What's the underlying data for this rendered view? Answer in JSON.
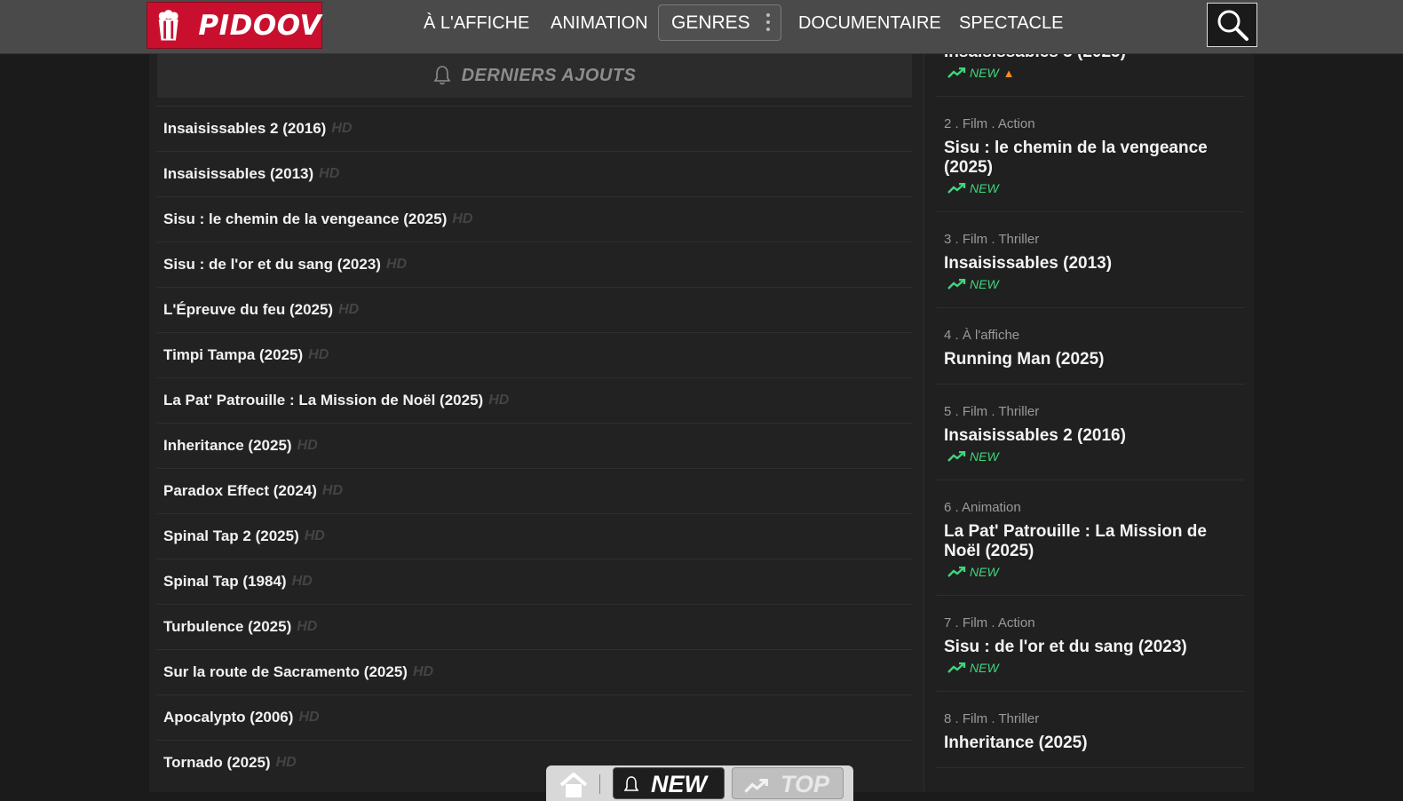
{
  "header": {
    "logo_text": "PIDOOV",
    "nav": {
      "affiche": "À L'AFFICHE",
      "animation": "ANIMATION",
      "genres": "GENRES",
      "documentaire": "DOCUMENTAIRE",
      "spectacle": "SPECTACLE"
    }
  },
  "main": {
    "section_title": "DERNIERS AJOUTS",
    "quality_label": "HD",
    "items": [
      "Insaisissables 2 (2016)",
      "Insaisissables (2013)",
      "Sisu : le chemin de la vengeance (2025)",
      "Sisu : de l'or et du sang (2023)",
      "L'Épreuve du feu (2025)",
      "Timpi Tampa (2025)",
      "La Pat' Patrouille : La Mission de Noël (2025)",
      "Inheritance (2025)",
      "Paradox Effect (2024)",
      "Spinal Tap 2 (2025)",
      "Spinal Tap (1984)",
      "Turbulence (2025)",
      "Sur la route de Sacramento (2025)",
      "Apocalypto (2006)",
      "Tornado (2025)"
    ]
  },
  "sidebar": {
    "new_label": "NEW",
    "items": [
      {
        "meta": "",
        "title": "Insaisissables 3 (2025)",
        "new": true,
        "hot": true
      },
      {
        "meta": "2 . Film . Action",
        "title": "Sisu : le chemin de la vengeance (2025)",
        "new": true
      },
      {
        "meta": "3 . Film . Thriller",
        "title": "Insaisissables (2013)",
        "new": true
      },
      {
        "meta": "4 . À l'affiche",
        "title": "Running Man (2025)",
        "new": false
      },
      {
        "meta": "5 . Film . Thriller",
        "title": "Insaisissables 2 (2016)",
        "new": true
      },
      {
        "meta": "6 . Animation",
        "title": "La Pat' Patrouille : La Mission de Noël (2025)",
        "new": true
      },
      {
        "meta": "7 . Film . Action",
        "title": "Sisu : de l'or et du sang (2023)",
        "new": true
      },
      {
        "meta": "8 . Film . Thriller",
        "title": "Inheritance (2025)",
        "new": false
      }
    ]
  },
  "toolbar": {
    "new_label": "NEW",
    "top_label": "TOP"
  },
  "colors": {
    "brand": "#c8102e",
    "new_badge": "#3fd67a",
    "header_bg": "#4a4a4a"
  }
}
